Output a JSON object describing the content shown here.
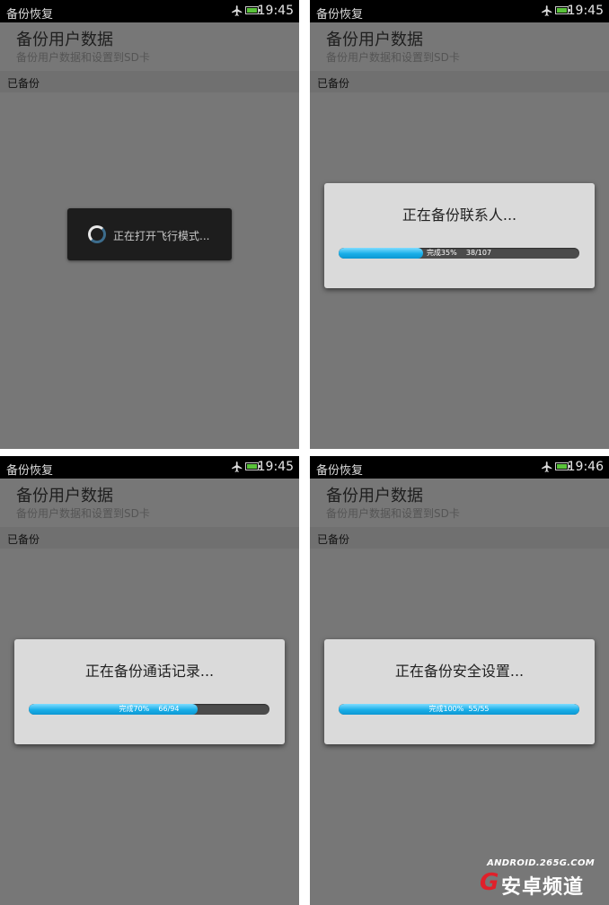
{
  "app_title": "备份恢复",
  "screens": [
    {
      "clock": "19:45",
      "header_title": "备份用户数据",
      "header_sub": "备份用户数据和设置到SD卡",
      "section": "已备份",
      "toast": "正在打开飞行模式..."
    },
    {
      "clock": "19:45",
      "header_title": "备份用户数据",
      "header_sub": "备份用户数据和设置到SD卡",
      "section": "已备份",
      "dialog": "正在备份联系人...",
      "progress_text": "完成35%    38/107",
      "progress": 0.35
    },
    {
      "clock": "19:45",
      "header_title": "备份用户数据",
      "header_sub": "备份用户数据和设置到SD卡",
      "section": "已备份",
      "dialog": "正在备份通话记录...",
      "progress_text": "完成70%    66/94",
      "progress": 0.7
    },
    {
      "clock": "19:46",
      "header_title": "备份用户数据",
      "header_sub": "备份用户数据和设置到SD卡",
      "section": "已备份",
      "dialog": "正在备份安全设置...",
      "progress_text": "完成100%  55/55",
      "progress": 1.0
    }
  ],
  "watermark": {
    "top": "ANDROID.265G.COM",
    "letter": "G",
    "text": "安卓频道"
  },
  "colors": {
    "progress_fill": "#19aee8",
    "battery": "#59c23a"
  }
}
